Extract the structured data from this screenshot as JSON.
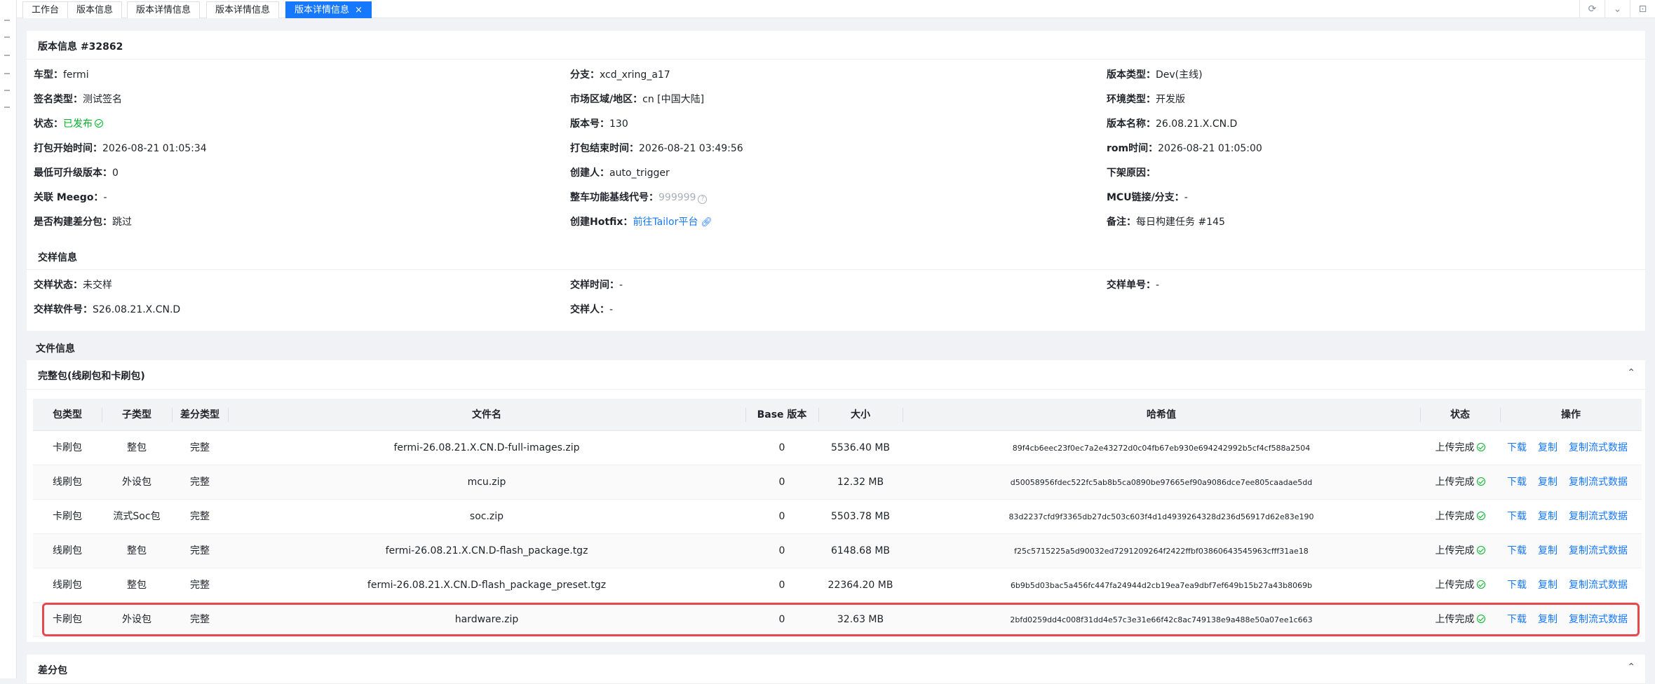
{
  "tabs": [
    {
      "label": "工作台",
      "active": false
    },
    {
      "label": "版本信息",
      "active": false
    },
    {
      "label": "版本详情信息",
      "active": false
    },
    {
      "label": "版本详情信息",
      "active": false
    },
    {
      "label": "版本详情信息",
      "active": true,
      "close": "×"
    }
  ],
  "tools": {
    "refresh_icon": "⟳",
    "expand_icon": "⌄",
    "menu_icon": "⊡"
  },
  "version_info": {
    "title": "版本信息 #32862",
    "rows": [
      [
        {
          "k": "车型：",
          "v": "fermi"
        },
        {
          "k": "分支：",
          "v": "xcd_xring_a17"
        },
        {
          "k": "版本类型：",
          "v": "Dev(主线)"
        }
      ],
      [
        {
          "k": "签名类型：",
          "v": "测试签名"
        },
        {
          "k": "市场区域/地区：",
          "v": "cn [中国大陆]"
        },
        {
          "k": "环境类型：",
          "v": "开发版"
        }
      ],
      [
        {
          "k": "状态：",
          "v": "已发布"
        },
        {
          "k": "版本号：",
          "v": "130"
        },
        {
          "k": "版本名称：",
          "v": "26.08.21.X.CN.D"
        }
      ],
      [
        {
          "k": "打包开始时间：",
          "v": "2026-08-21 01:05:34"
        },
        {
          "k": "打包结束时间：",
          "v": "2026-08-21 03:49:56"
        },
        {
          "k": "rom时间：",
          "v": "2026-08-21 01:05:00"
        }
      ],
      [
        {
          "k": "最低可升级版本：",
          "v": "0"
        },
        {
          "k": "创建人：",
          "v": "auto_trigger"
        },
        {
          "k": "下架原因：",
          "v": ""
        }
      ],
      [
        {
          "k": "关联 Meego：",
          "v": "-"
        },
        {
          "k": "整车功能基线代号：",
          "v": "999999"
        },
        {
          "k": "MCU链接/分支：",
          "v": "-"
        }
      ],
      [
        {
          "k": "是否构建差分包：",
          "v": "跳过"
        },
        {
          "k": "创建Hotfix：",
          "v": "前往Tailor平台"
        },
        {
          "k": "备注：",
          "v": "每日构建任务 #145"
        }
      ]
    ]
  },
  "sample_info": {
    "title": "交样信息",
    "rows": [
      [
        {
          "k": "交样状态：",
          "v": "未交样"
        },
        {
          "k": "交样时间：",
          "v": "-"
        },
        {
          "k": "交样单号：",
          "v": "-"
        }
      ],
      [
        {
          "k": "交样软件号：",
          "v": "S26.08.21.X.CN.D"
        },
        {
          "k": "交样人：",
          "v": "-"
        }
      ]
    ]
  },
  "file_info": {
    "title": "文件信息",
    "full_package_title": "完整包(线刷包和卡刷包)",
    "diff_package_title": "差分包",
    "collapse_icon": "⌃",
    "columns": [
      "包类型",
      "子类型",
      "差分类型",
      "文件名",
      "Base 版本",
      "大小",
      "哈希值",
      "状态",
      "操作"
    ],
    "rows": [
      [
        "卡刷包",
        "整包",
        "完整",
        "fermi-26.08.21.X.CN.D-full-images.zip",
        "0",
        "5536.40 MB",
        "89f4cb6eec23f0ec7a2e43272d0c04fb67eb930e694242992b5cf4cf588a2504",
        "上传完成"
      ],
      [
        "线刷包",
        "外设包",
        "完整",
        "mcu.zip",
        "0",
        "12.32 MB",
        "d50058956fdec522fc5ab8b5ca0890be97665ef90a9086dce7ee805caadae5dd",
        "上传完成"
      ],
      [
        "卡刷包",
        "流式Soc包",
        "完整",
        "soc.zip",
        "0",
        "5503.78 MB",
        "83d2237cfd9f3365db27dc503c603f4d1d4939264328d236d56917d62e83e190",
        "上传完成"
      ],
      [
        "线刷包",
        "整包",
        "完整",
        "fermi-26.08.21.X.CN.D-flash_package.tgz",
        "0",
        "6148.68 MB",
        "f25c5715225a5d90032ed7291209264f2422ffbf03860643545963cfff31ae18",
        "上传完成"
      ],
      [
        "线刷包",
        "整包",
        "完整",
        "fermi-26.08.21.X.CN.D-flash_package_preset.tgz",
        "0",
        "22364.20 MB",
        "6b9b5d03bac5a456fc447fa24944d2cb19ea7ea9dbf7ef649b15b27a43b8069b",
        "上传完成"
      ],
      [
        "卡刷包",
        "外设包",
        "完整",
        "hardware.zip",
        "0",
        "32.63 MB",
        "2bfd0259dd4c008f31dd4e57c3e31e66f42c8ac749138e9a488e50a07ee1c663",
        "上传完成"
      ]
    ],
    "ops": [
      "下载",
      "复制",
      "复制流式数据"
    ]
  }
}
